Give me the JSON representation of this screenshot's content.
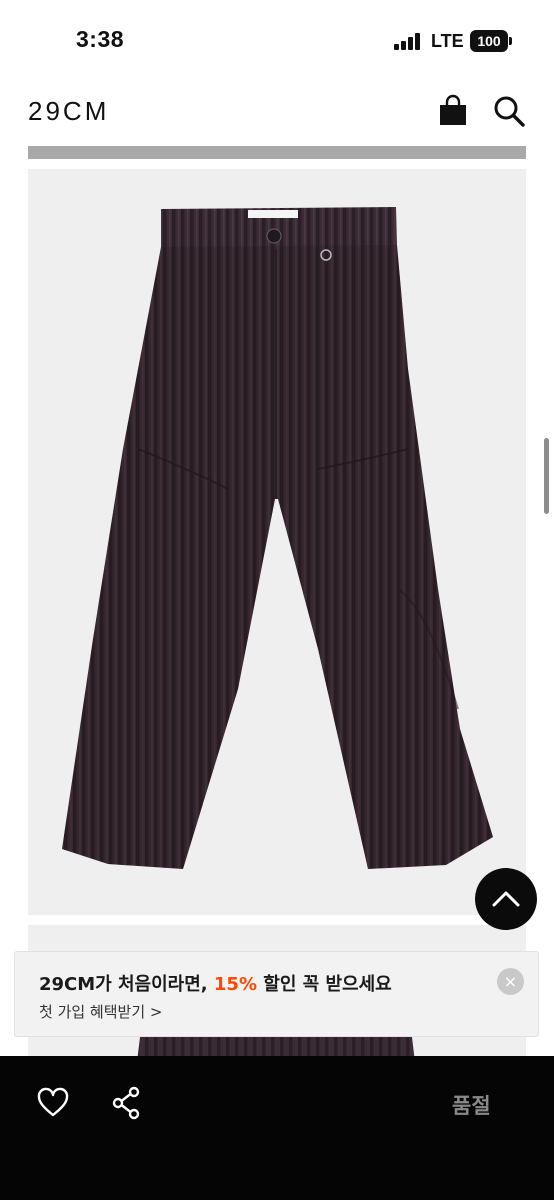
{
  "status_bar": {
    "time": "3:38",
    "network": "LTE",
    "battery": "100"
  },
  "header": {
    "logo": "29CM",
    "icons": [
      "shopping-bag-icon",
      "search-icon"
    ]
  },
  "product": {
    "images": [
      "corduroy-wide-pants-front",
      "corduroy-wide-pants-detail"
    ],
    "colors": {
      "fabric": "#3a2a33",
      "background": "#efefef"
    }
  },
  "banner": {
    "headline_prefix": "29CM가 처음이라면, ",
    "headline_highlight": "15%",
    "headline_suffix": " 할인 꼭 받으세요",
    "subline": "첫 가입 혜택받기 >",
    "close": "×",
    "accent_color": "#ff4800"
  },
  "bottom_bar": {
    "status_label": "품절",
    "icons": [
      "heart-icon",
      "share-icon"
    ]
  }
}
